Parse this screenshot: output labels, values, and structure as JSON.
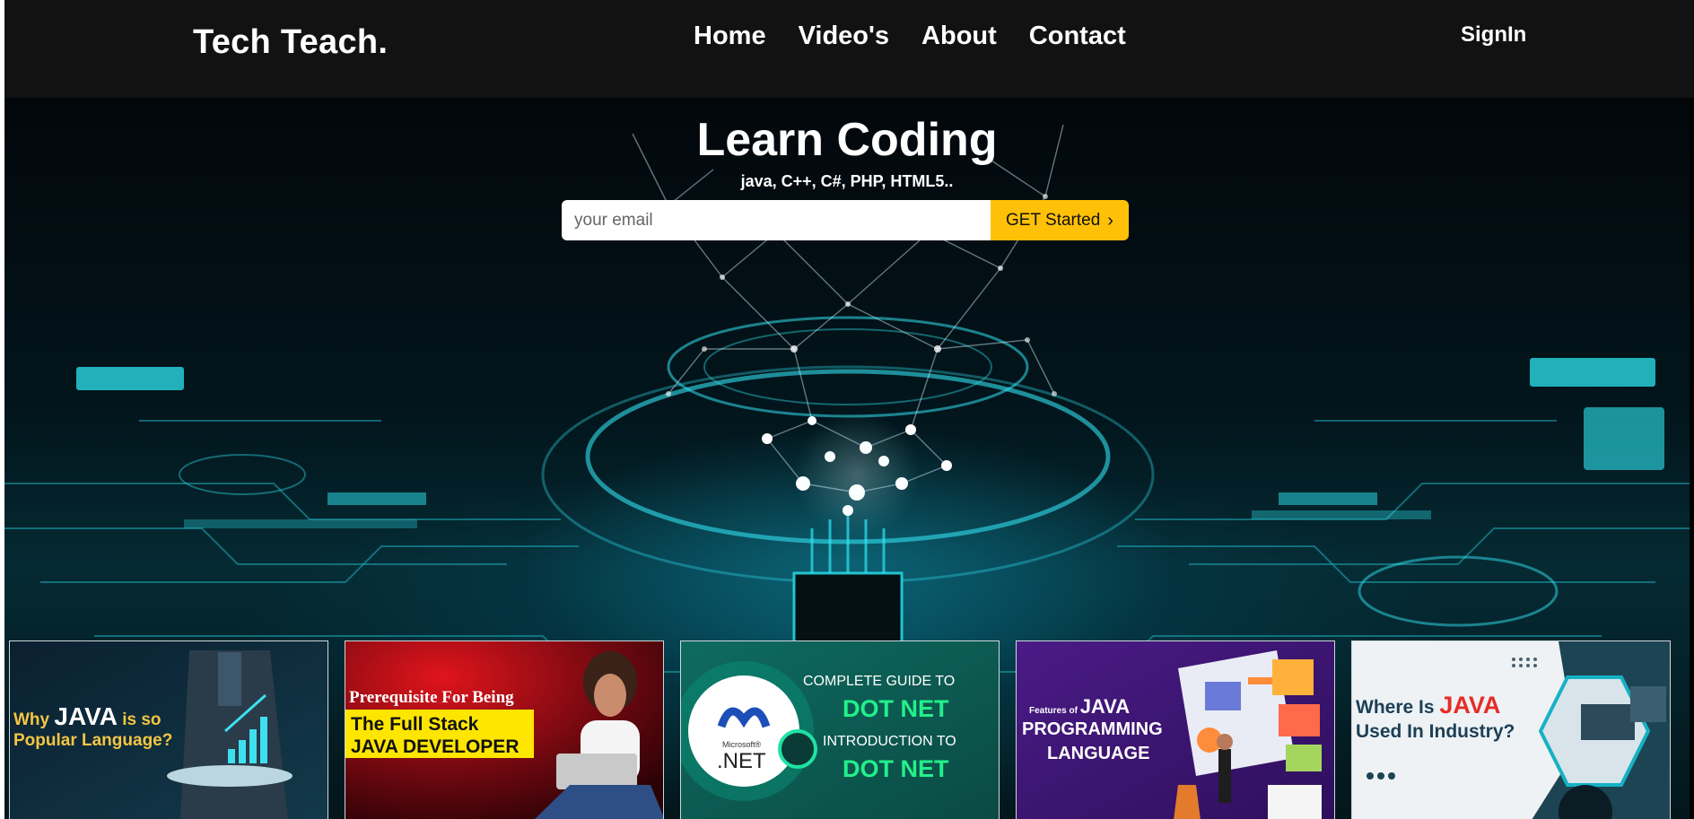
{
  "brand": "Tech Teach.",
  "nav": {
    "home": "Home",
    "videos": "Video's",
    "about": "About",
    "contact": "Contact"
  },
  "signin": "SignIn",
  "hero": {
    "title": "Learn Coding",
    "subtitle": "java, C++, C#, PHP, HTML5..",
    "email_placeholder": "your email",
    "cta_label": "GET Started"
  },
  "cards": [
    {
      "line1a": "Why ",
      "line1b": "JAVA",
      "line1c": " is so",
      "line2": "Popular Language?"
    },
    {
      "line1": "Prerequisite For Being",
      "line2": "The Full Stack",
      "line3": "JAVA DEVELOPER"
    },
    {
      "line1": "COMPLETE GUIDE TO",
      "line2": "DOT NET",
      "line3": "INTRODUCTION TO",
      "line4": "DOT NET",
      "logo_small": "Microsoft®",
      "logo_big": ".NET"
    },
    {
      "line0a": "Features of ",
      "line0b": "JAVA",
      "line1": "PROGRAMMING",
      "line2": "LANGUAGE"
    },
    {
      "line1a": "Where Is ",
      "line1b": "JAVA",
      "line2": "Used In Industry?"
    }
  ],
  "colors": {
    "header_bg": "#121212",
    "cta": "#ffc107",
    "accent_cyan": "#1fd6e6"
  }
}
